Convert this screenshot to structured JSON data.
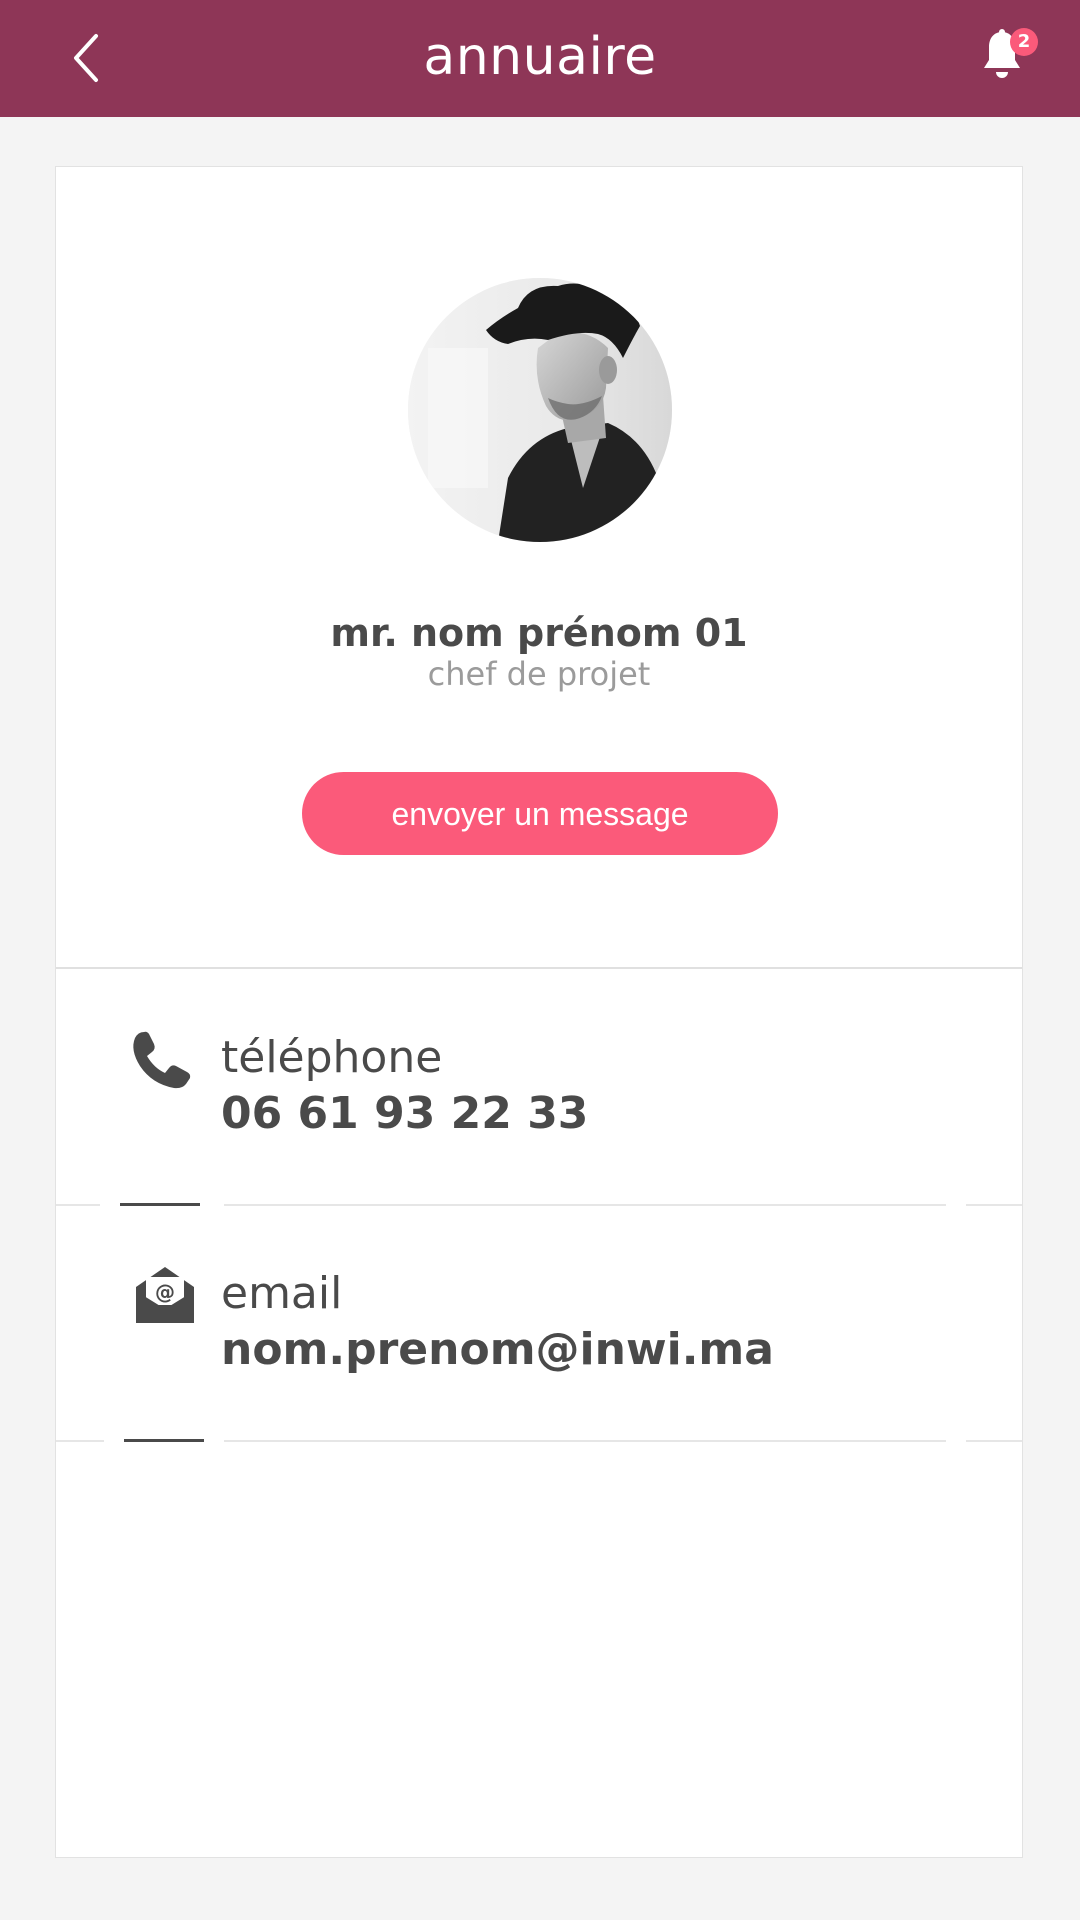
{
  "header": {
    "title": "annuaire",
    "notification_count": "2",
    "colors": {
      "background": "#8e3657",
      "badge": "#fb5a7a"
    },
    "icons": {
      "back": "chevron-left-icon",
      "notifications": "bell-icon"
    }
  },
  "profile": {
    "name": "mr. nom prénom 01",
    "role": "chef de projet",
    "avatar": "profile-photo"
  },
  "actions": {
    "message_label": "envoyer un message",
    "accent_color": "#fb5a7a"
  },
  "contact": {
    "phone": {
      "label": "téléphone",
      "value": "06 61 93 22 33",
      "icon": "phone-icon"
    },
    "email": {
      "label": "email",
      "value": "nom.prenom@inwi.ma",
      "icon": "email-icon"
    }
  }
}
